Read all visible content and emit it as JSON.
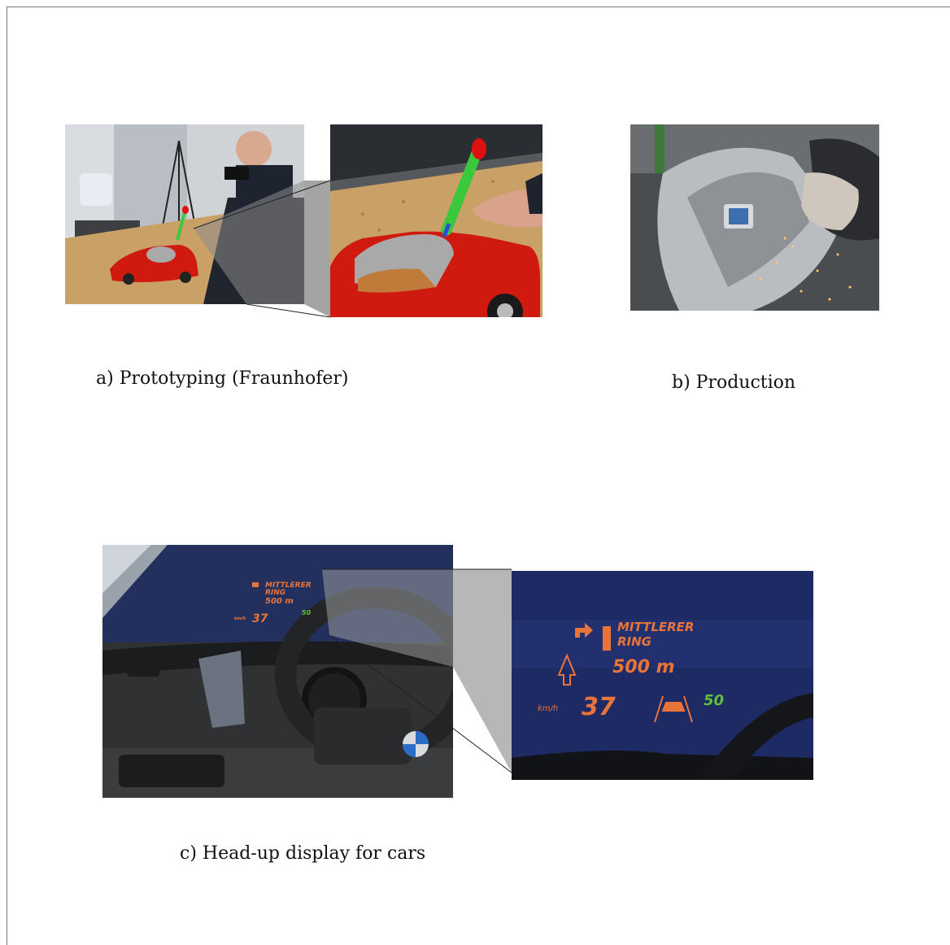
{
  "captions": {
    "a": "a) Prototyping (Fraunhofer)",
    "b": "b) Production",
    "c": "c) Head-up display for cars"
  },
  "hud": {
    "street_line1": "MITTLERER",
    "street_line2": "RING",
    "distance": "500 m",
    "speed_unit": "km/h",
    "speed": "37",
    "limit": "50"
  },
  "colors": {
    "hud_orange": "#e8743a",
    "hud_green": "#5cc23c",
    "hud_background": "#1d2a63",
    "car_red": "#d01a10",
    "table_osb": "#c9a066"
  }
}
